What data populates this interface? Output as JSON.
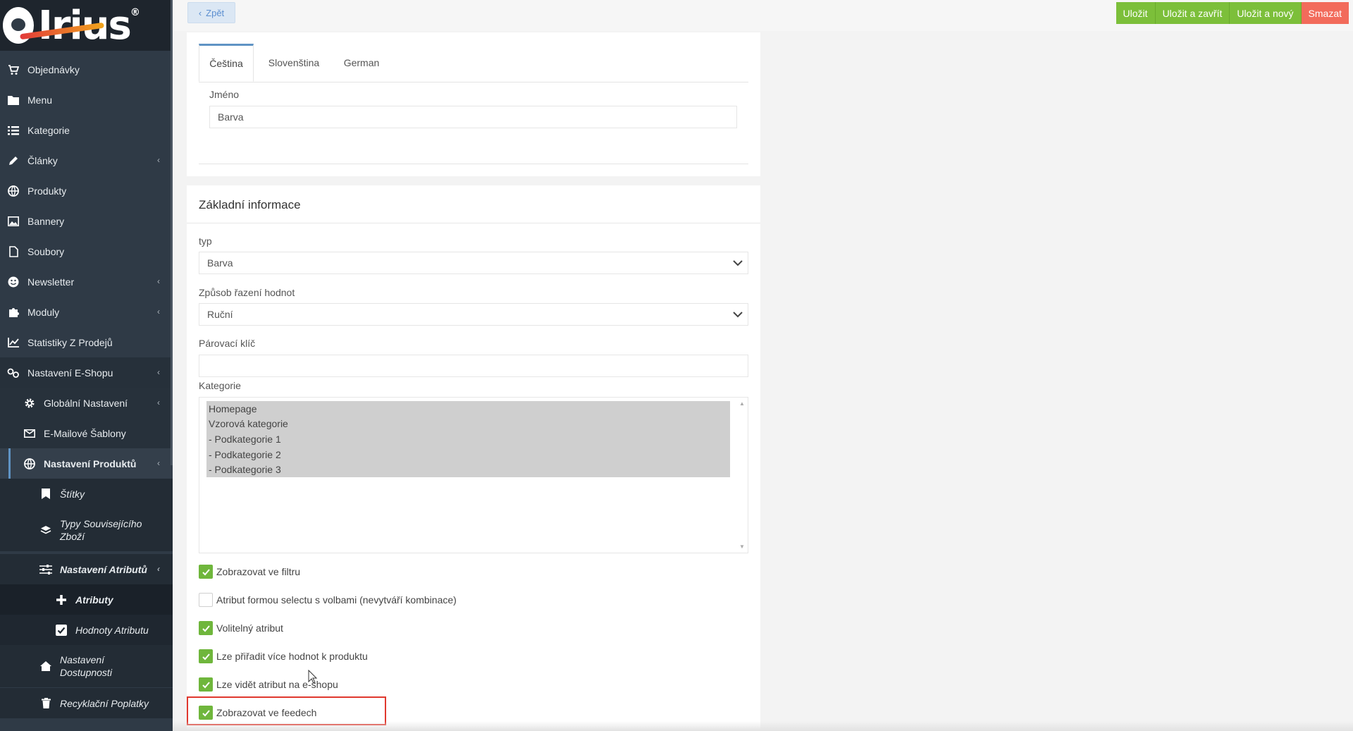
{
  "logo": {
    "text": "Irius",
    "reg": "®"
  },
  "sidebar": {
    "items": [
      {
        "label": "Objednávky",
        "icon": "cart-icon"
      },
      {
        "label": "Menu",
        "icon": "folder-icon"
      },
      {
        "label": "Kategorie",
        "icon": "list-icon"
      },
      {
        "label": "Články",
        "icon": "pencil-icon"
      },
      {
        "label": "Produkty",
        "icon": "ball-icon"
      },
      {
        "label": "Bannery",
        "icon": "image-icon"
      },
      {
        "label": "Soubory",
        "icon": "file-icon"
      },
      {
        "label": "Newsletter",
        "icon": "smile-icon"
      },
      {
        "label": "Moduly",
        "icon": "puzzle-icon"
      },
      {
        "label": "Statistiky Z Prodejů",
        "icon": "chart-icon"
      },
      {
        "label": "Nastavení E-Shopu",
        "icon": "cogs-icon"
      }
    ],
    "sub": [
      {
        "label": "Globální Nastavení",
        "icon": "gear-icon"
      },
      {
        "label": "E-Mailové Šablony",
        "icon": "mail-icon"
      },
      {
        "label": "Nastavení Produktů",
        "icon": "ball-icon"
      }
    ],
    "sub2": [
      {
        "label": "Štítky",
        "icon": "bookmark-icon"
      },
      {
        "label_1": "Typy Souvisejícího",
        "label_2": "Zboží",
        "icon": "layers-icon"
      },
      {
        "label": "Nastavení Atributů",
        "icon": "sliders-icon"
      }
    ],
    "sub3": [
      {
        "label": "Atributy",
        "icon": "plus-icon"
      },
      {
        "label": "Hodnoty Atributu",
        "icon": "checkbox-icon"
      }
    ],
    "sub2b": [
      {
        "label_1": "Nastavení",
        "label_2": "Dostupnosti",
        "icon": "home-icon"
      },
      {
        "label": "Recyklační Poplatky",
        "icon": "trash-icon"
      }
    ]
  },
  "toolbar": {
    "back_label": "Zpět",
    "save": "Uložit",
    "save_close": "Uložit a zavřít",
    "save_new": "Uložit a nový",
    "delete": "Smazat"
  },
  "lang": {
    "tabs": [
      "Čeština",
      "Slovenština",
      "German"
    ],
    "name_label": "Jméno",
    "name_value": "Barva"
  },
  "basic": {
    "title": "Základní informace",
    "type_label": "typ",
    "type_value": "Barva",
    "sort_label": "Způsob řazení hodnot",
    "sort_value": "Ruční",
    "pair_label": "Párovací klíč",
    "pair_value": "",
    "category_label": "Kategorie",
    "categories": [
      "Homepage",
      "Vzorová kategorie",
      "- Podkategorie 1",
      "- Podkategorie 2",
      "- Podkategorie 3"
    ],
    "checks": [
      {
        "label": "Zobrazovat ve filtru",
        "checked": true
      },
      {
        "label": "Atribut formou selectu s volbami (nevytváří kombinace)",
        "checked": false
      },
      {
        "label": "Volitelný atribut",
        "checked": true
      },
      {
        "label": "Lze přiřadit více hodnot k produktu",
        "checked": true
      },
      {
        "label": "Lze vidět atribut na e-shopu",
        "checked": true
      },
      {
        "label": "Zobrazovat ve feedech",
        "checked": true
      }
    ]
  },
  "colors": {
    "accent_green": "#7cbf3a",
    "danger": "#f26b5b",
    "sidebar": "#2f3a46",
    "highlight_box": "#e0382e"
  }
}
